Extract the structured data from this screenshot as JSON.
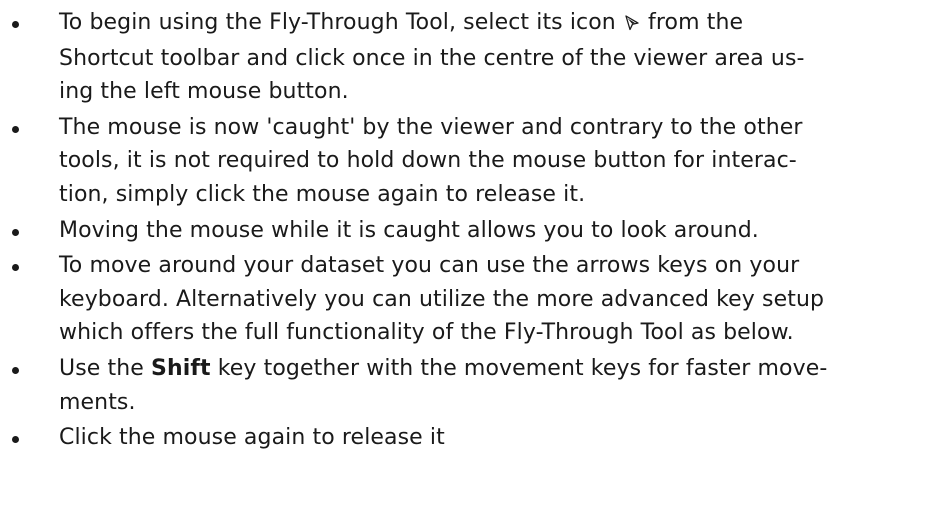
{
  "bullets": [
    {
      "lines": [
        {
          "before": "To begin using the Fly-Through Tool, select its icon ",
          "icon": "fly-through-cursor-icon",
          "after": " from the"
        },
        {
          "text": "Shortcut toolbar and click once in the centre of the viewer area us-"
        },
        {
          "text": "ing the left mouse button."
        }
      ]
    },
    {
      "lines": [
        {
          "text": "The mouse is now 'caught' by the viewer and contrary to the other"
        },
        {
          "text": "tools, it is not required to hold down the mouse button for interac-"
        },
        {
          "text": "tion, simply click the mouse again to release it."
        }
      ]
    },
    {
      "lines": [
        {
          "text": "Moving the mouse while it is caught allows you to look around."
        }
      ]
    },
    {
      "lines": [
        {
          "text": "To move around your dataset you can use the arrows keys on your"
        },
        {
          "text": "keyboard. Alternatively you can utilize the more advanced key setup"
        },
        {
          "text": "which offers the full functionality of the Fly-Through Tool as below."
        }
      ]
    },
    {
      "lines": [
        {
          "before": "Use the ",
          "bold": "Shift",
          "after": " key together with the movement keys for faster move-"
        },
        {
          "text": "ments."
        }
      ]
    },
    {
      "lines": [
        {
          "text": "Click the mouse again to release it"
        }
      ]
    }
  ]
}
